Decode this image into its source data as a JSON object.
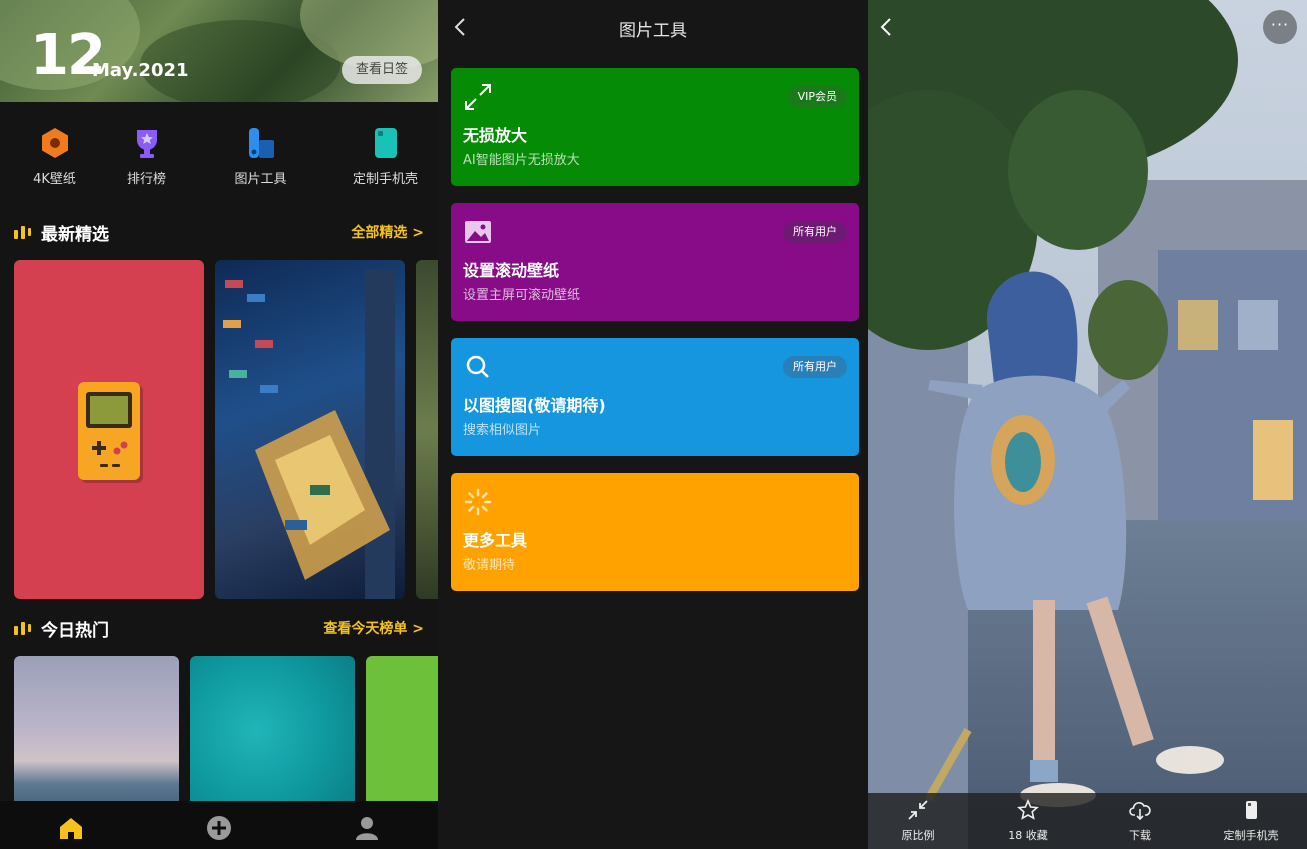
{
  "home": {
    "date_day": "12",
    "date_month": "May.2021",
    "calendar_button": "查看日签",
    "quick_entries": [
      {
        "label": "4K壁纸",
        "icon": "hexagon-flower-icon",
        "color": "#f07b1f"
      },
      {
        "label": "排行榜",
        "icon": "trophy-icon",
        "color": "#8a5cf5"
      },
      {
        "label": "图片工具",
        "icon": "swatch-tools-icon",
        "color": "#2d8ef0"
      },
      {
        "label": "定制手机壳",
        "icon": "phone-case-icon",
        "color": "#19c2b5"
      }
    ],
    "section_latest": {
      "title": "最新精选",
      "more": "全部精选 >"
    },
    "section_hot": {
      "title": "今日热门",
      "more": "查看今天榜单 >"
    },
    "nav": [
      {
        "label": "home",
        "icon": "home-icon",
        "active": true
      },
      {
        "label": "add",
        "icon": "plus-circle-icon",
        "active": false
      },
      {
        "label": "profile",
        "icon": "user-icon",
        "active": false
      }
    ],
    "accent": "#f4c21b"
  },
  "tools": {
    "title": "图片工具",
    "cards": [
      {
        "icon": "expand-arrows-icon",
        "title": "无损放大",
        "subtitle": "AI智能图片无损放大",
        "badge": "VIP会员",
        "color": "#058b05",
        "badge_bg": "#1a7a1a"
      },
      {
        "icon": "image-icon",
        "title": "设置滚动壁纸",
        "subtitle": "设置主屏可滚动壁纸",
        "badge": "所有用户",
        "color": "#880b88",
        "badge_bg": "#6d1a72"
      },
      {
        "icon": "search-icon",
        "title": "以图搜图(敬请期待)",
        "subtitle": "搜索相似图片",
        "badge": "所有用户",
        "color": "#1596df",
        "badge_bg": "#2a7fb8"
      },
      {
        "icon": "loading-spinner-icon",
        "title": "更多工具",
        "subtitle": "敬请期待",
        "badge": "",
        "color": "#ffa200",
        "badge_bg": ""
      }
    ]
  },
  "viewer": {
    "more_label": "···",
    "actions": [
      {
        "label": "原比例",
        "icon": "shrink-arrows-icon"
      },
      {
        "label": "18 收藏",
        "icon": "star-icon"
      },
      {
        "label": "下载",
        "icon": "cloud-download-icon"
      },
      {
        "label": "定制手机壳",
        "icon": "phone-icon"
      }
    ]
  }
}
